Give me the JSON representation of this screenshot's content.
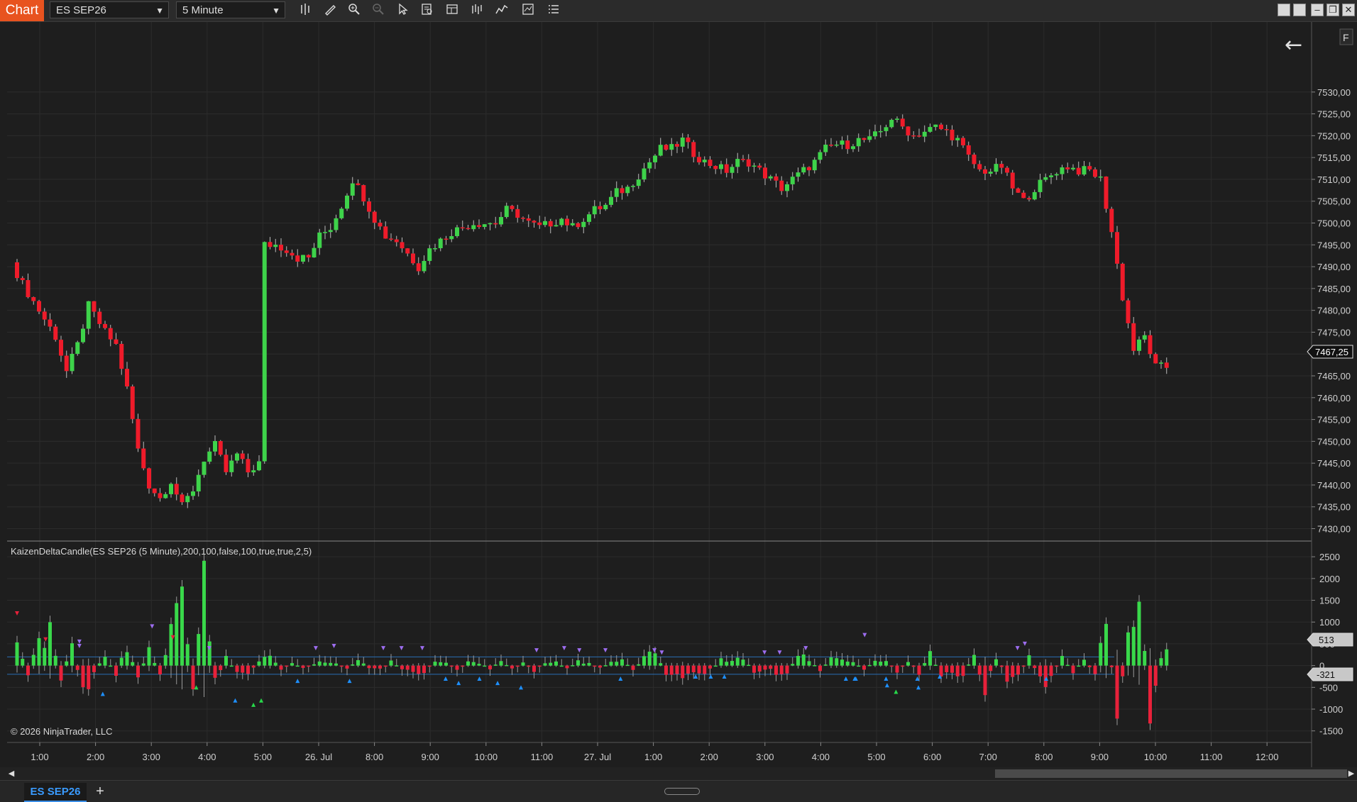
{
  "toolbar": {
    "chart_tab": "Chart",
    "instrument": "ES SEP26",
    "interval": "5 Minute",
    "icons": [
      "bar-type-icon",
      "drawing-tool-icon",
      "zoom-in-icon",
      "zoom-out-icon",
      "pointer-icon",
      "data-box-icon",
      "properties-icon",
      "strategies-icon",
      "indicators-icon",
      "templates-icon",
      "list-icon"
    ]
  },
  "window": {
    "buttons": [
      "tile-icon",
      "tile-alt-icon",
      "minimize-icon",
      "restore-icon",
      "close-icon"
    ]
  },
  "chart": {
    "indicator_label": "KaizenDeltaCandle(ES SEP26 (5 Minute),200,100,false,100,true,true,2,5)",
    "copyright": "© 2026 NinjaTrader, LLC",
    "price_badge": "7467,25",
    "pos_badge": "513",
    "neg_badge": "-321",
    "corner_label": "F",
    "back_arrow": "←"
  },
  "chart_data": {
    "type": "candlestick",
    "price_axis": {
      "ticks": [
        "7530,00",
        "7525,00",
        "7520,00",
        "7515,00",
        "7510,00",
        "7505,00",
        "7500,00",
        "7495,00",
        "7490,00",
        "7485,00",
        "7480,00",
        "7475,00",
        "7470,00",
        "7465,00",
        "7460,00",
        "7455,00",
        "7450,00",
        "7445,00",
        "7440,00",
        "7435,00",
        "7430,00"
      ],
      "range": [
        7427,
        7535
      ]
    },
    "delta_axis": {
      "ticks": [
        "2500",
        "2000",
        "1500",
        "1000",
        "500",
        "0",
        "-500",
        "-1000",
        "-1500"
      ],
      "range": [
        -1700,
        2600
      ]
    },
    "time_axis": [
      "1:00",
      "2:00",
      "3:00",
      "4:00",
      "5:00",
      "26. Jul",
      "8:00",
      "9:00",
      "10:00",
      "11:00",
      "27. Jul",
      "1:00",
      "2:00",
      "3:00",
      "4:00",
      "5:00",
      "6:00",
      "7:00",
      "8:00",
      "9:00",
      "10:00",
      "11:00",
      "12:00"
    ],
    "series_colors": {
      "up": "#3ed34a",
      "down": "#ef1b2a",
      "up_delta": "#39d84a",
      "down_delta": "#e8213a"
    },
    "price_path": [
      [
        0,
        7491
      ],
      [
        2,
        7486
      ],
      [
        5,
        7480
      ],
      [
        8,
        7474
      ],
      [
        10,
        7466
      ],
      [
        12,
        7472
      ],
      [
        14,
        7481
      ],
      [
        17,
        7475
      ],
      [
        19,
        7472
      ],
      [
        21,
        7462
      ],
      [
        23,
        7448
      ],
      [
        25,
        7440
      ],
      [
        27,
        7437
      ],
      [
        29,
        7441
      ],
      [
        31,
        7435
      ],
      [
        33,
        7439
      ],
      [
        35,
        7446
      ],
      [
        37,
        7449
      ],
      [
        39,
        7443
      ],
      [
        41,
        7447
      ],
      [
        43,
        7443
      ],
      [
        45,
        7445
      ],
      [
        46,
        7495
      ],
      [
        48,
        7495
      ],
      [
        50,
        7494
      ],
      [
        52,
        7492
      ],
      [
        54,
        7492
      ],
      [
        56,
        7497
      ],
      [
        58,
        7499
      ],
      [
        60,
        7504
      ],
      [
        62,
        7510
      ],
      [
        64,
        7506
      ],
      [
        66,
        7501
      ],
      [
        68,
        7497
      ],
      [
        70,
        7496
      ],
      [
        72,
        7493
      ],
      [
        74,
        7490
      ],
      [
        76,
        7494
      ],
      [
        78,
        7496
      ],
      [
        80,
        7498
      ],
      [
        82,
        7499
      ],
      [
        84,
        7500
      ],
      [
        86,
        7500
      ],
      [
        88,
        7500
      ],
      [
        90,
        7503
      ],
      [
        92,
        7502
      ],
      [
        94,
        7500
      ],
      [
        96,
        7499
      ],
      [
        98,
        7500
      ],
      [
        100,
        7501
      ],
      [
        102,
        7499
      ],
      [
        104,
        7501
      ],
      [
        106,
        7503
      ],
      [
        108,
        7504
      ],
      [
        110,
        7507
      ],
      [
        112,
        7508
      ],
      [
        114,
        7511
      ],
      [
        116,
        7514
      ],
      [
        118,
        7517
      ],
      [
        120,
        7517
      ],
      [
        122,
        7519
      ],
      [
        124,
        7516
      ],
      [
        126,
        7514
      ],
      [
        128,
        7513
      ],
      [
        130,
        7512
      ],
      [
        132,
        7514
      ],
      [
        134,
        7514
      ],
      [
        136,
        7512
      ],
      [
        138,
        7510
      ],
      [
        140,
        7508
      ],
      [
        142,
        7510
      ],
      [
        144,
        7512
      ],
      [
        146,
        7514
      ],
      [
        148,
        7517
      ],
      [
        150,
        7518
      ],
      [
        152,
        7518
      ],
      [
        154,
        7519
      ],
      [
        156,
        7519
      ],
      [
        158,
        7521
      ],
      [
        160,
        7524
      ],
      [
        162,
        7522
      ],
      [
        164,
        7520
      ],
      [
        166,
        7521
      ],
      [
        168,
        7522
      ],
      [
        170,
        7521
      ],
      [
        172,
        7519
      ],
      [
        174,
        7515
      ],
      [
        176,
        7512
      ],
      [
        178,
        7512
      ],
      [
        180,
        7513
      ],
      [
        182,
        7508
      ],
      [
        184,
        7505
      ],
      [
        186,
        7508
      ],
      [
        188,
        7510
      ],
      [
        190,
        7512
      ],
      [
        192,
        7513
      ],
      [
        194,
        7512
      ],
      [
        196,
        7512
      ],
      [
        198,
        7510
      ],
      [
        200,
        7498
      ],
      [
        202,
        7483
      ],
      [
        204,
        7471
      ],
      [
        206,
        7474
      ],
      [
        208,
        7467
      ]
    ],
    "delta_profile": [
      [
        0,
        800
      ],
      [
        2,
        -300
      ],
      [
        4,
        700
      ],
      [
        6,
        800
      ],
      [
        8,
        -400
      ],
      [
        10,
        600
      ],
      [
        12,
        -800
      ],
      [
        14,
        -200
      ],
      [
        16,
        300
      ],
      [
        18,
        -300
      ],
      [
        20,
        700
      ],
      [
        22,
        -400
      ],
      [
        24,
        500
      ],
      [
        26,
        -300
      ],
      [
        28,
        1000
      ],
      [
        30,
        1900
      ],
      [
        32,
        -500
      ],
      [
        34,
        2000
      ],
      [
        36,
        -400
      ],
      [
        38,
        200
      ],
      [
        40,
        -200
      ],
      [
        42,
        -300
      ],
      [
        44,
        150
      ],
      [
        46,
        300
      ],
      [
        48,
        -100
      ],
      [
        50,
        80
      ],
      [
        52,
        -80
      ],
      [
        54,
        60
      ],
      [
        56,
        150
      ],
      [
        58,
        100
      ],
      [
        60,
        -120
      ],
      [
        62,
        200
      ],
      [
        64,
        -80
      ],
      [
        66,
        -150
      ],
      [
        68,
        120
      ],
      [
        70,
        -100
      ],
      [
        72,
        -250
      ],
      [
        74,
        -200
      ],
      [
        76,
        150
      ],
      [
        78,
        100
      ],
      [
        80,
        -150
      ],
      [
        82,
        100
      ],
      [
        84,
        80
      ],
      [
        86,
        -80
      ],
      [
        88,
        120
      ],
      [
        90,
        -100
      ],
      [
        92,
        80
      ],
      [
        94,
        -150
      ],
      [
        96,
        100
      ],
      [
        98,
        80
      ],
      [
        100,
        -80
      ],
      [
        102,
        100
      ],
      [
        104,
        60
      ],
      [
        106,
        -80
      ],
      [
        108,
        100
      ],
      [
        110,
        150
      ],
      [
        112,
        -100
      ],
      [
        114,
        200
      ],
      [
        116,
        450
      ],
      [
        118,
        -200
      ],
      [
        120,
        -350
      ],
      [
        122,
        -250
      ],
      [
        124,
        -200
      ],
      [
        126,
        -150
      ],
      [
        128,
        150
      ],
      [
        130,
        120
      ],
      [
        132,
        200
      ],
      [
        134,
        -150
      ],
      [
        136,
        -100
      ],
      [
        138,
        -200
      ],
      [
        140,
        -150
      ],
      [
        142,
        250
      ],
      [
        144,
        180
      ],
      [
        146,
        -150
      ],
      [
        148,
        200
      ],
      [
        150,
        150
      ],
      [
        152,
        100
      ],
      [
        154,
        -100
      ],
      [
        156,
        150
      ],
      [
        158,
        120
      ],
      [
        160,
        -150
      ],
      [
        162,
        100
      ],
      [
        164,
        -200
      ],
      [
        166,
        300
      ],
      [
        168,
        -250
      ],
      [
        170,
        -200
      ],
      [
        172,
        -300
      ],
      [
        174,
        350
      ],
      [
        176,
        -750
      ],
      [
        178,
        300
      ],
      [
        180,
        -350
      ],
      [
        182,
        -400
      ],
      [
        184,
        350
      ],
      [
        186,
        -500
      ],
      [
        188,
        -300
      ],
      [
        190,
        250
      ],
      [
        192,
        -200
      ],
      [
        194,
        200
      ],
      [
        196,
        -300
      ],
      [
        198,
        1200
      ],
      [
        200,
        -1300
      ],
      [
        202,
        900
      ],
      [
        204,
        2100
      ],
      [
        206,
        -1500
      ],
      [
        208,
        300
      ]
    ]
  }
}
